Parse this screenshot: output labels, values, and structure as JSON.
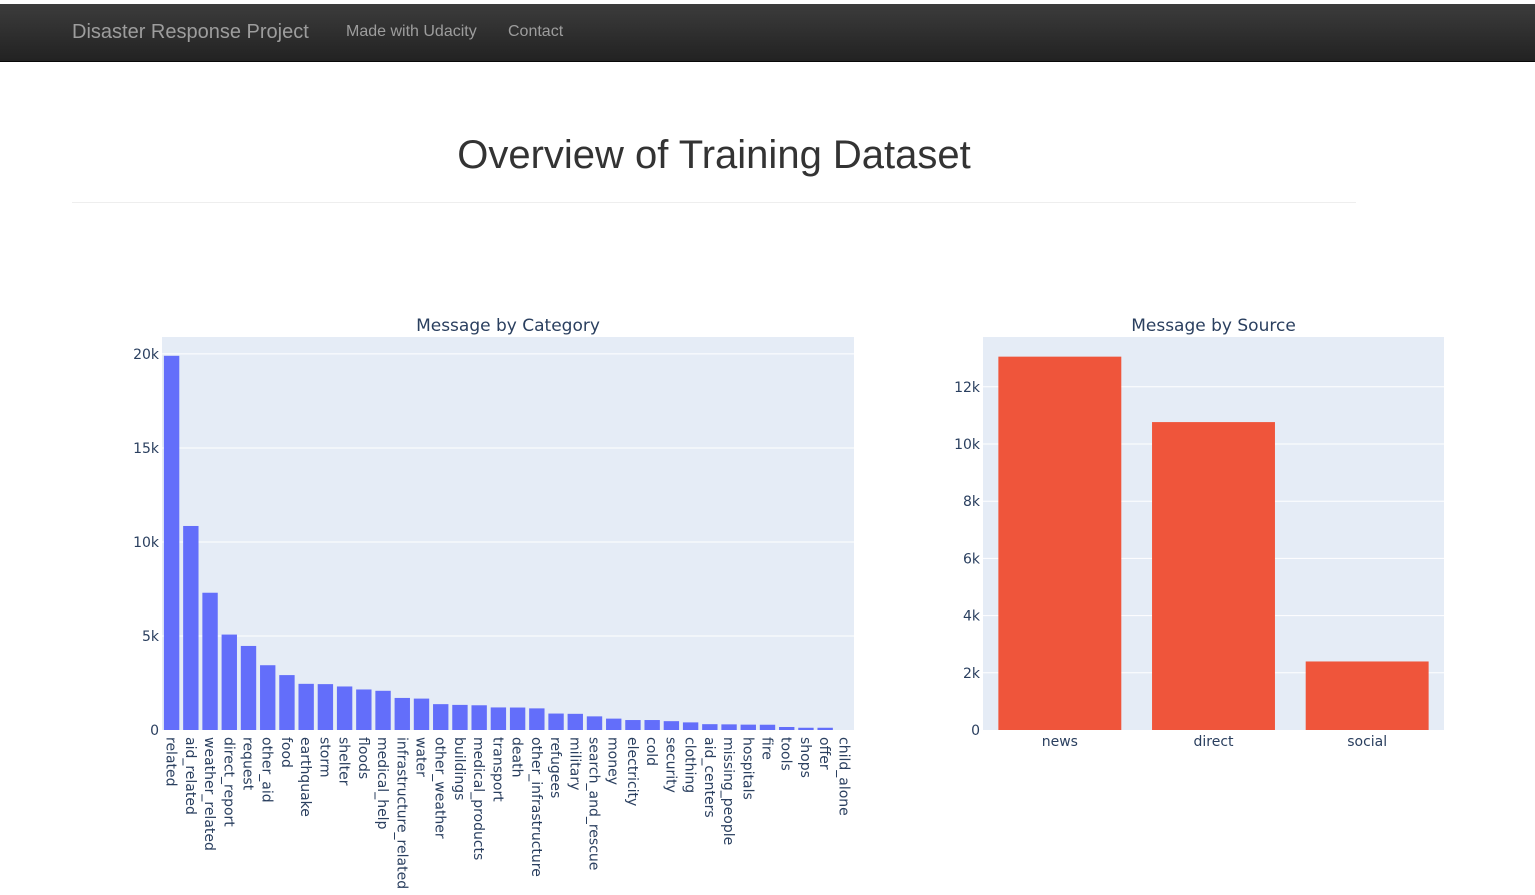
{
  "nav": {
    "brand": "Disaster Response Project",
    "links": [
      "Made with Udacity",
      "Contact"
    ]
  },
  "header": {
    "title": "Overview of Training Dataset"
  },
  "colors": {
    "category_bar": "#636efa",
    "source_bar": "#ef553b",
    "plot_bg": "#e5ecf6",
    "navbar": "#222222"
  },
  "chart_data": [
    {
      "type": "bar",
      "title": "Message by Category",
      "categories": [
        "related",
        "aid_related",
        "weather_related",
        "direct_report",
        "request",
        "other_aid",
        "food",
        "earthquake",
        "storm",
        "shelter",
        "floods",
        "medical_help",
        "infrastructure_related",
        "water",
        "other_weather",
        "buildings",
        "medical_products",
        "transport",
        "death",
        "other_infrastructure",
        "refugees",
        "military",
        "search_and_rescue",
        "money",
        "electricity",
        "cold",
        "security",
        "clothing",
        "aid_centers",
        "missing_people",
        "hospitals",
        "fire",
        "tools",
        "shops",
        "offer",
        "child_alone"
      ],
      "values": [
        19900,
        10850,
        7300,
        5075,
        4470,
        3445,
        2920,
        2455,
        2440,
        2315,
        2155,
        2085,
        1705,
        1670,
        1375,
        1335,
        1315,
        1200,
        1195,
        1150,
        875,
        860,
        725,
        605,
        530,
        530,
        470,
        405,
        310,
        300,
        285,
        280,
        160,
        120,
        120,
        0
      ],
      "ylim": [
        0,
        20900
      ],
      "yticks": [
        0,
        5000,
        10000,
        15000,
        20000
      ],
      "ytick_labels": [
        "0",
        "5k",
        "10k",
        "15k",
        "20k"
      ],
      "grid": true
    },
    {
      "type": "bar",
      "title": "Message by Source",
      "categories": [
        "news",
        "direct",
        "social"
      ],
      "values": [
        13054,
        10766,
        2396
      ],
      "ylim": [
        0,
        13741
      ],
      "yticks": [
        0,
        2000,
        4000,
        6000,
        8000,
        10000,
        12000
      ],
      "ytick_labels": [
        "0",
        "2k",
        "4k",
        "6k",
        "8k",
        "10k",
        "12k"
      ],
      "grid": true
    }
  ]
}
